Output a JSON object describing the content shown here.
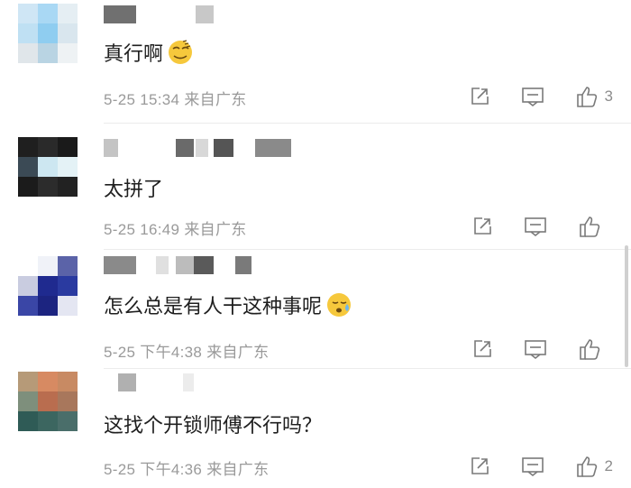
{
  "comments": [
    {
      "text": "真行啊",
      "emoji": "smirk-face-emoji",
      "date": "5-25",
      "time": "15:34",
      "location": "来自广东",
      "like_count": "3",
      "avatar_colors": [
        "#cfe6f5",
        "#a9d8f4",
        "#e5eef3",
        "#bfe0f3",
        "#8fcdf0",
        "#d9e6ee",
        "#e0e6ea",
        "#b9d4e3",
        "#eef2f4"
      ]
    },
    {
      "text": "太拼了",
      "emoji": "",
      "date": "5-25",
      "time": "16:49",
      "location": "来自广东",
      "like_count": "",
      "avatar_colors": [
        "#1f1f1f",
        "#2a2a2a",
        "#1a1a1a",
        "#3b4a55",
        "#cde7f1",
        "#e4f2f6",
        "#1b1b1b",
        "#2c2c2c",
        "#222222"
      ]
    },
    {
      "text": "怎么总是有人干这种事呢",
      "emoji": "sweat-face-emoji",
      "date": "5-25",
      "time": "下午4:38",
      "location": "来自广东",
      "like_count": "",
      "avatar_colors": [
        "#ffffff",
        "#f0f2f8",
        "#5b63a8",
        "#c9cce0",
        "#1f2a8f",
        "#2a3aa0",
        "#3a46a6",
        "#1c2480",
        "#e4e6f2"
      ]
    },
    {
      "text": "这找个开锁师傅不行吗？",
      "emoji": "",
      "date": "5-25",
      "time": "下午4:36",
      "location": "来自广东",
      "like_count": "2",
      "avatar_colors": [
        "#b69a78",
        "#d78a62",
        "#c88a63",
        "#7e8f7c",
        "#b96d4f",
        "#a8775c",
        "#2f5b56",
        "#3c6660",
        "#4a6e6a"
      ]
    }
  ],
  "icons": {
    "share": "share-icon",
    "reply": "comment-icon",
    "like": "thumbs-up-icon"
  },
  "colors": {
    "meta_text": "#9a9a9a",
    "icon": "#7a7a7a",
    "divider": "#ececec"
  }
}
